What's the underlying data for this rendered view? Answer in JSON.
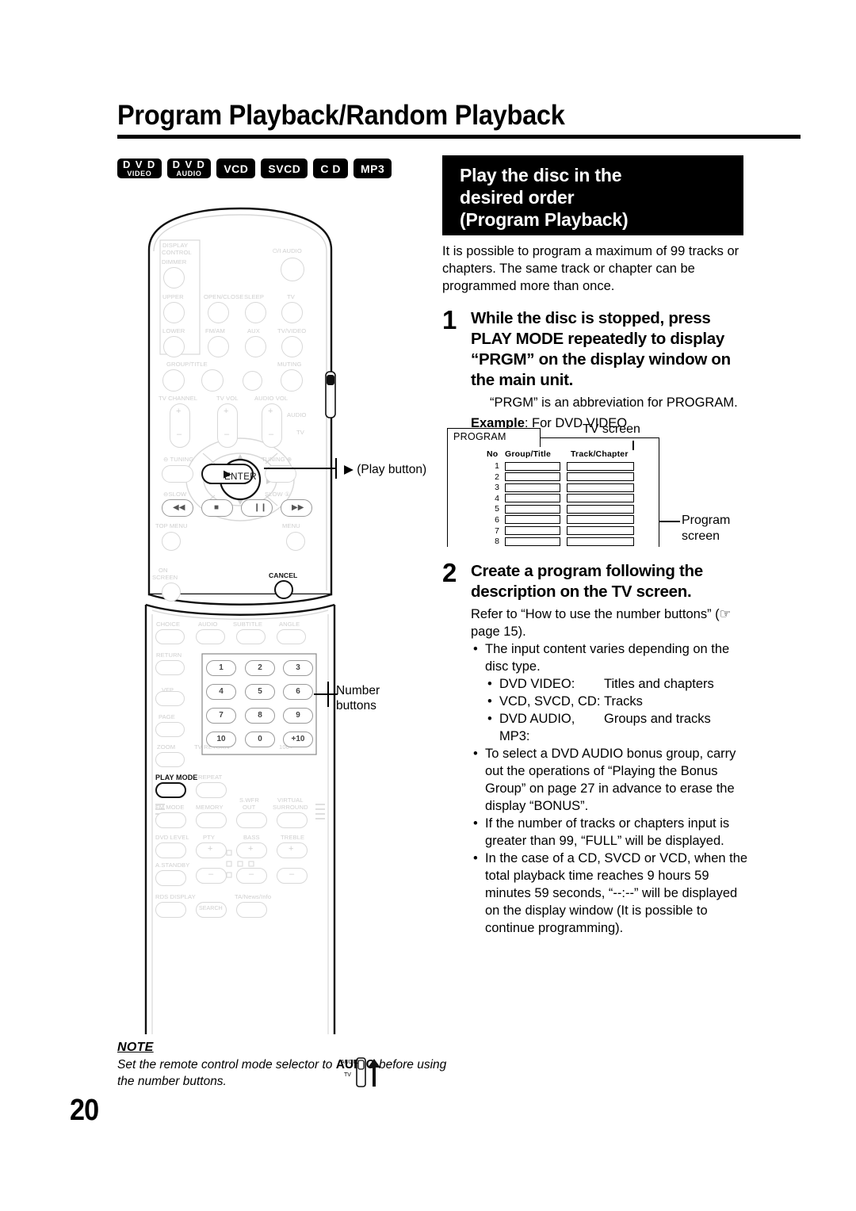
{
  "page": {
    "title": "Program Playback/Random Playback",
    "number": "20"
  },
  "badges": [
    {
      "line1": "D V D",
      "line2": "VIDEO"
    },
    {
      "line1": "D V D",
      "line2": "AUDIO"
    },
    {
      "line1": "VCD",
      "line2": ""
    },
    {
      "line1": "SVCD",
      "line2": ""
    },
    {
      "line1": "C D",
      "line2": ""
    },
    {
      "line1": "MP3",
      "line2": ""
    }
  ],
  "black_header": {
    "line1": "Play the disc in the",
    "line2": "desired order",
    "line3": "(Program Playback)"
  },
  "intro": "It is possible to program a maximum of 99 tracks or chapters. The same track or chapter can be programmed more than once.",
  "step1": {
    "number": "1",
    "title": "While the disc is stopped, press PLAY MODE repeatedly to display “PRGM” on the display window on the main unit.",
    "note": "“PRGM” is an abbreviation for PROGRAM.",
    "example_label": "Example",
    "example_rest": ": For DVD VIDEO"
  },
  "figure": {
    "tab_label": "PROGRAM",
    "columns": [
      "No",
      "Group/Title",
      "Track/Chapter"
    ],
    "rows": [
      "1",
      "2",
      "3",
      "4",
      "5",
      "6",
      "7",
      "8"
    ],
    "tv_screen_label": "TV screen",
    "program_screen_label_line1": "Program",
    "program_screen_label_line2": "screen"
  },
  "step2": {
    "number": "2",
    "title": "Create a program following the description on the TV screen.",
    "refer": "Refer to “How to use the number buttons” (☞ page 15).",
    "bullets": [
      {
        "text": "The input content varies depending on the disc type.",
        "sub": [
          {
            "key": "DVD VIDEO:",
            "val": "Titles and chapters"
          },
          {
            "key": "VCD, SVCD, CD:",
            "val": "Tracks"
          },
          {
            "key": "DVD AUDIO, MP3:",
            "val": "Groups and tracks"
          }
        ]
      },
      {
        "text": "To select a DVD AUDIO bonus group, carry out the operations of “Playing the Bonus Group” on page 27 in advance to erase the display “BONUS”.",
        "sub": []
      },
      {
        "text": "If the number of tracks or chapters input is greater than 99, “FULL” will be displayed.",
        "sub": []
      },
      {
        "text": "In the case of a CD, SVCD or VCD, when the total playback time reaches 9 hours 59 minutes 59 seconds, “--:--” will be displayed on the display window (It is possible to continue programming).",
        "sub": []
      }
    ]
  },
  "callouts": {
    "play_button": "▶ (Play button)",
    "number_buttons_line1": "Number",
    "number_buttons_line2": "buttons"
  },
  "remote": {
    "labels": {
      "display_control_line1": "DISPLAY",
      "display_control_line2": "CONTROL",
      "dimmer": "DIMMER",
      "upper": "UPPER",
      "lower": "LOWER",
      "open_close": "OPEN/CLOSE",
      "sleep": "SLEEP",
      "standby_audio": "⏻/I AUDIO",
      "tv": "TV",
      "tv_power": "⏻/I",
      "fm_am": "FM/AM",
      "aux": "AUX",
      "tv_video": "TV/VIDEO",
      "group_title": "GROUP/TITLE",
      "muting": "MUTING",
      "tv_channel": "TV CHANNEL",
      "tv_vol": "TV VOL",
      "audio_vol": "AUDIO VOL",
      "audio": "AUDIO",
      "tv_sel": "TV",
      "tuning_minus": "⊖ TUNING",
      "tuning_plus": "TUNING ⊕",
      "slow_minus": "⊖SLOW",
      "slow_plus": "SLOW ①",
      "top_menu": "TOP MENU",
      "menu": "MENU",
      "on_screen_line1": "ON",
      "on_screen_line2": "SCREEN",
      "enter": "ENTER",
      "cancel": "CANCEL",
      "choice": "CHOICE",
      "audio2": "AUDIO",
      "subtitle": "SUBTITLE",
      "angle": "ANGLE",
      "return": "RETURN",
      "vfp": "VFP",
      "page": "PAGE",
      "zoom": "ZOOM",
      "tv_return": "TV RETURN",
      "hundred_plus": "100+",
      "play_mode": "PLAY MODE",
      "repeat": "REPEAT",
      "fm_mode": "FM MODE",
      "memory": "MEMORY",
      "swfr_line1": "S.WFR",
      "swfr_line2": "OUT",
      "virtual_line1": "VIRTUAL",
      "virtual_line2": "SURROUND",
      "dvd_level": "DVD LEVEL",
      "pty": "PTY",
      "bass": "BASS",
      "treble": "TREBLE",
      "a_standby": "A.STANDBY",
      "rds_display": "RDS DISPLAY",
      "ta_news_info": "TA/News/Info",
      "search": "SEARCH"
    },
    "numbers": [
      "1",
      "2",
      "3",
      "4",
      "5",
      "6",
      "7",
      "8",
      "9",
      "10",
      "0",
      "+10"
    ]
  },
  "note": {
    "heading": "NOTE",
    "text_a": "Set the remote control mode selector to ",
    "text_b": "AUDIO",
    "text_c": " before using the number buttons.",
    "selector_top": "AUDIO",
    "selector_bottom": "TV"
  }
}
